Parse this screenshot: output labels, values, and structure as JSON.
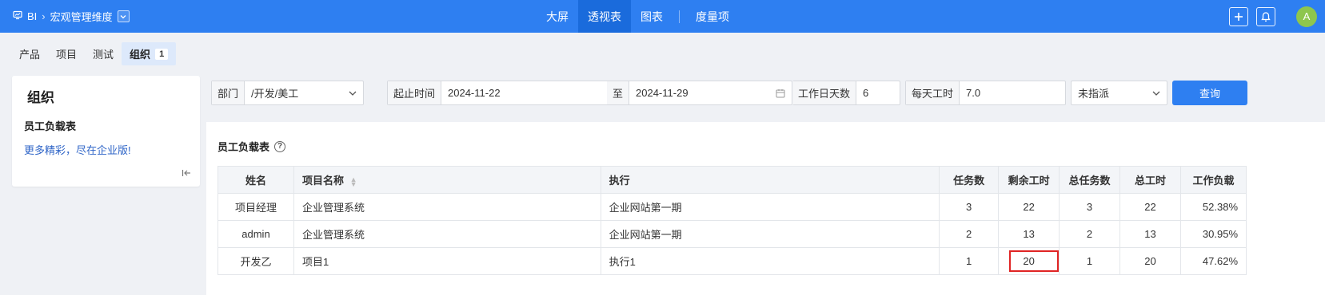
{
  "header": {
    "brand": "BI",
    "breadcrumb": "宏观管理维度",
    "nav_tabs": [
      {
        "label": "大屏"
      },
      {
        "label": "透视表"
      },
      {
        "label": "图表"
      },
      {
        "label": "度量项"
      }
    ],
    "active_tab": "透视表",
    "avatar_letter": "A",
    "accent_color": "#2e7ff1"
  },
  "subtabs": [
    {
      "label": "产品"
    },
    {
      "label": "项目"
    },
    {
      "label": "测试"
    },
    {
      "label": "组织",
      "badge": "1"
    }
  ],
  "sidebar": {
    "title": "组织",
    "item": "员工负载表",
    "promo_link": "更多精彩，尽在企业版!"
  },
  "filters": {
    "dept_label": "部门",
    "dept_value": "/开发/美工",
    "start_label": "起止时间",
    "start_value": "2024-11-22",
    "to_label": "至",
    "end_value": "2024-11-29",
    "workdays_label": "工作日天数",
    "workdays_value": "6",
    "hours_label": "每天工时",
    "hours_value": "7.0",
    "assign_value": "未指派",
    "query_button": "查询"
  },
  "report": {
    "title": "员工负载表",
    "columns": [
      "姓名",
      "项目名称",
      "执行",
      "任务数",
      "剩余工时",
      "总任务数",
      "总工时",
      "工作负载"
    ],
    "rows": [
      {
        "name": "项目经理",
        "project": "企业管理系统",
        "execution": "企业网站第一期",
        "tasks": "3",
        "remaining": "22",
        "total_tasks": "3",
        "total_hours": "22",
        "load": "52.38%"
      },
      {
        "name": "admin",
        "project": "企业管理系统",
        "execution": "企业网站第一期",
        "tasks": "2",
        "remaining": "13",
        "total_tasks": "2",
        "total_hours": "13",
        "load": "30.95%"
      },
      {
        "name": "开发乙",
        "project": "项目1",
        "execution": "执行1",
        "tasks": "1",
        "remaining": "20",
        "total_tasks": "1",
        "total_hours": "20",
        "load": "47.62%"
      }
    ],
    "highlight_color": "#e02424"
  }
}
